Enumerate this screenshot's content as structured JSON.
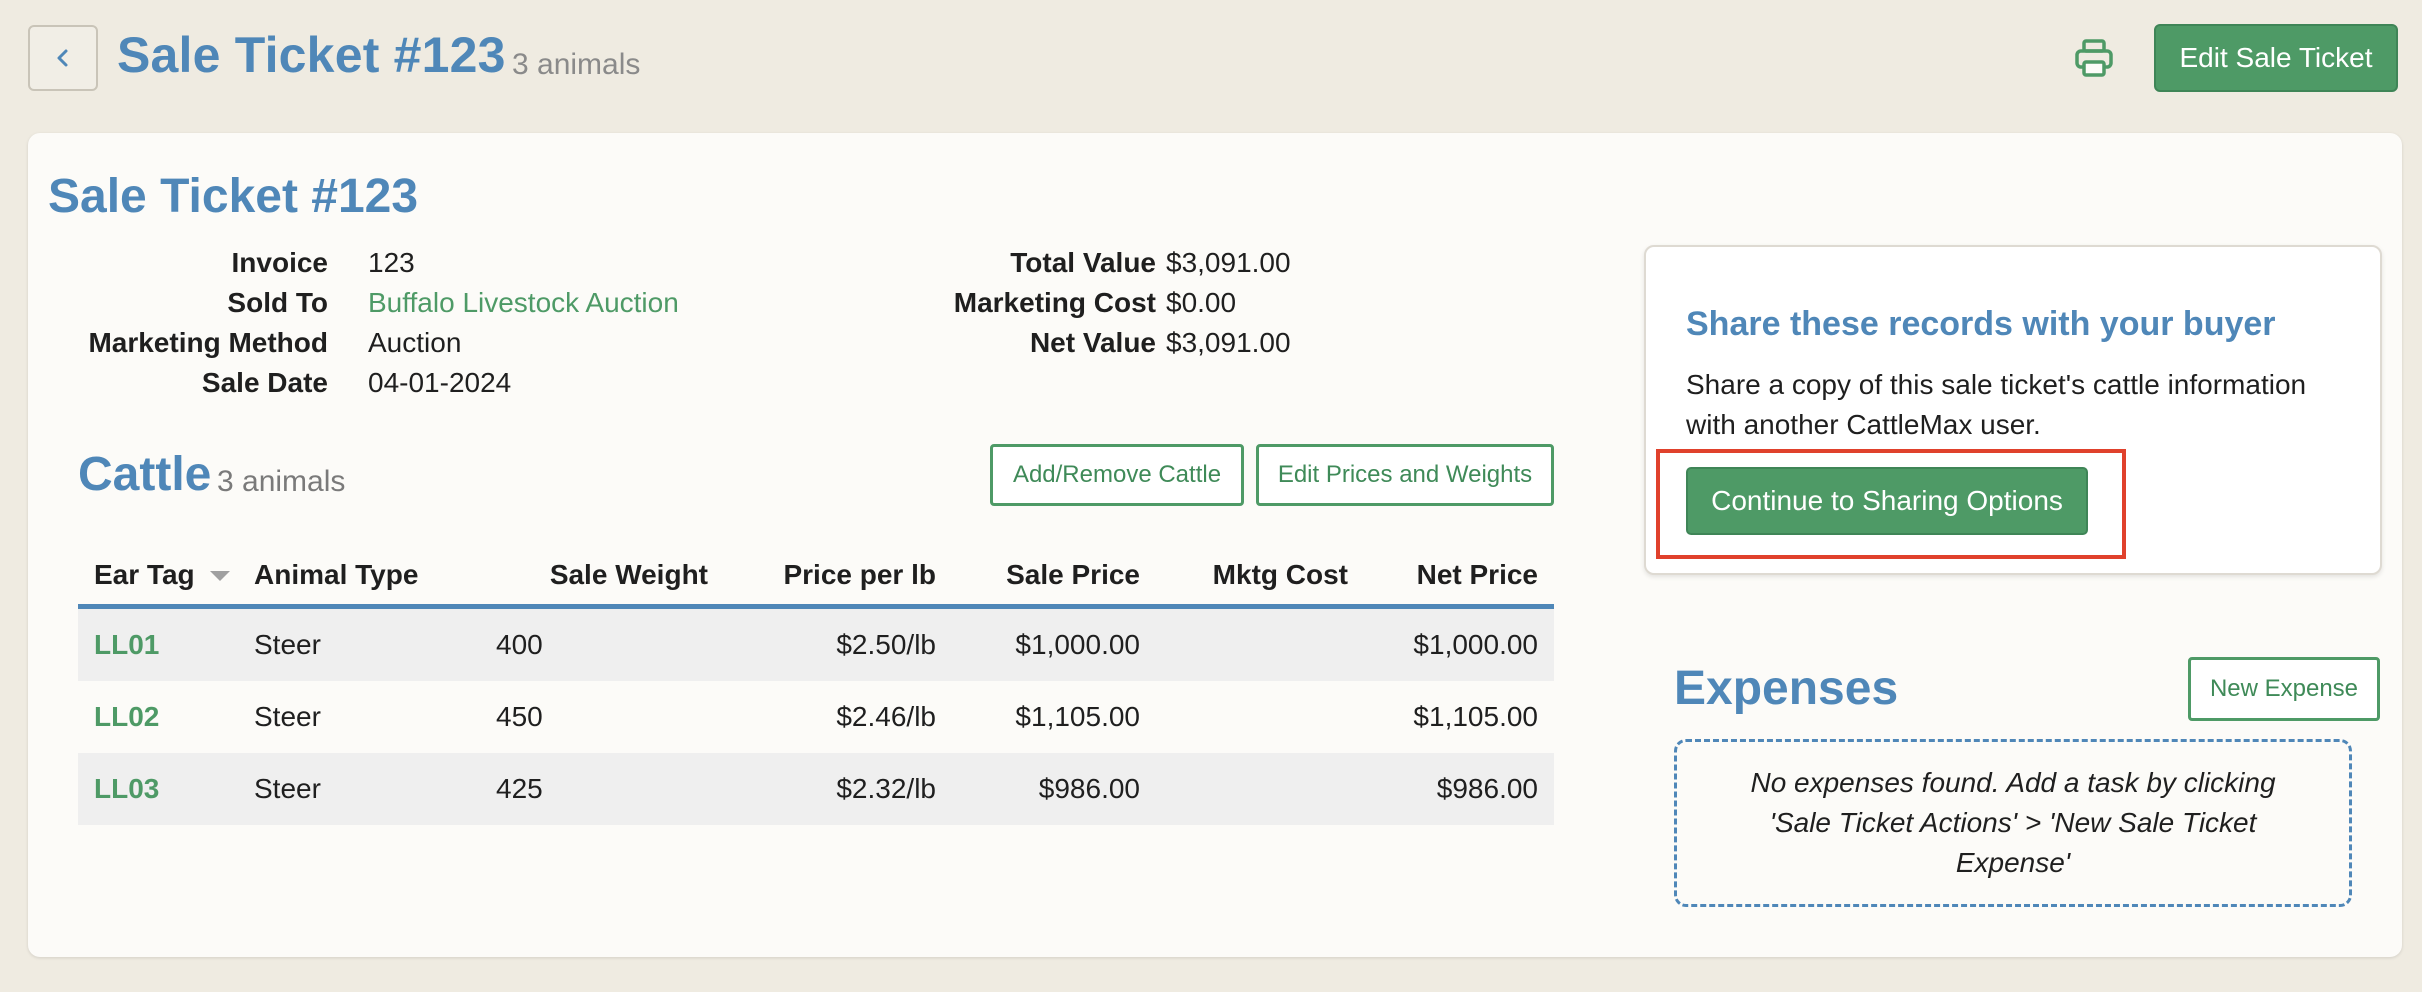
{
  "header": {
    "title": "Sale Ticket #123",
    "animal_count": "3 animals",
    "edit_button": "Edit Sale Ticket",
    "icons": {
      "back": "chevron-left-icon",
      "print": "printer-icon"
    }
  },
  "ticket": {
    "title": "Sale Ticket #123",
    "details_left": [
      {
        "label": "Invoice",
        "value": "123"
      },
      {
        "label": "Sold To",
        "value": "Buffalo Livestock Auction"
      },
      {
        "label": "Marketing Method",
        "value": "Auction"
      },
      {
        "label": "Sale Date",
        "value": "04-01-2024"
      }
    ],
    "details_right": [
      {
        "label": "Total Value",
        "value": "$3,091.00"
      },
      {
        "label": "Marketing Cost",
        "value": "$0.00"
      },
      {
        "label": "Net Value",
        "value": "$3,091.00"
      }
    ]
  },
  "cattle": {
    "title": "Cattle",
    "count": "3 animals",
    "add_remove_button": "Add/Remove Cattle",
    "edit_prices_button": "Edit Prices and Weights",
    "columns": [
      "Ear Tag",
      "Animal Type",
      "Sale Weight",
      "Price per lb",
      "Sale Price",
      "Mktg Cost",
      "Net Price"
    ],
    "rows": [
      {
        "ear_tag": "LL01",
        "animal_type": "Steer",
        "sale_weight": "400",
        "price_per_lb": "$2.50/lb",
        "sale_price": "$1,000.00",
        "mktg_cost": "",
        "net_price": "$1,000.00"
      },
      {
        "ear_tag": "LL02",
        "animal_type": "Steer",
        "sale_weight": "450",
        "price_per_lb": "$2.46/lb",
        "sale_price": "$1,105.00",
        "mktg_cost": "",
        "net_price": "$1,105.00"
      },
      {
        "ear_tag": "LL03",
        "animal_type": "Steer",
        "sale_weight": "425",
        "price_per_lb": "$2.32/lb",
        "sale_price": "$986.00",
        "mktg_cost": "",
        "net_price": "$986.00"
      }
    ]
  },
  "share": {
    "title": "Share these records with your buyer",
    "description": "Share a copy of this sale ticket's cattle information with another CattleMax user.",
    "button": "Continue to Sharing Options"
  },
  "expenses": {
    "title": "Expenses",
    "new_button": "New Expense",
    "empty_message": "No expenses found. Add a task by clicking 'Sale Ticket Actions' > 'New Sale Ticket Expense'"
  },
  "colors": {
    "accent_blue": "#4f87b8",
    "brand_green": "#4e9a66",
    "highlight_red": "#e0412c",
    "page_bg": "#efebe1"
  }
}
